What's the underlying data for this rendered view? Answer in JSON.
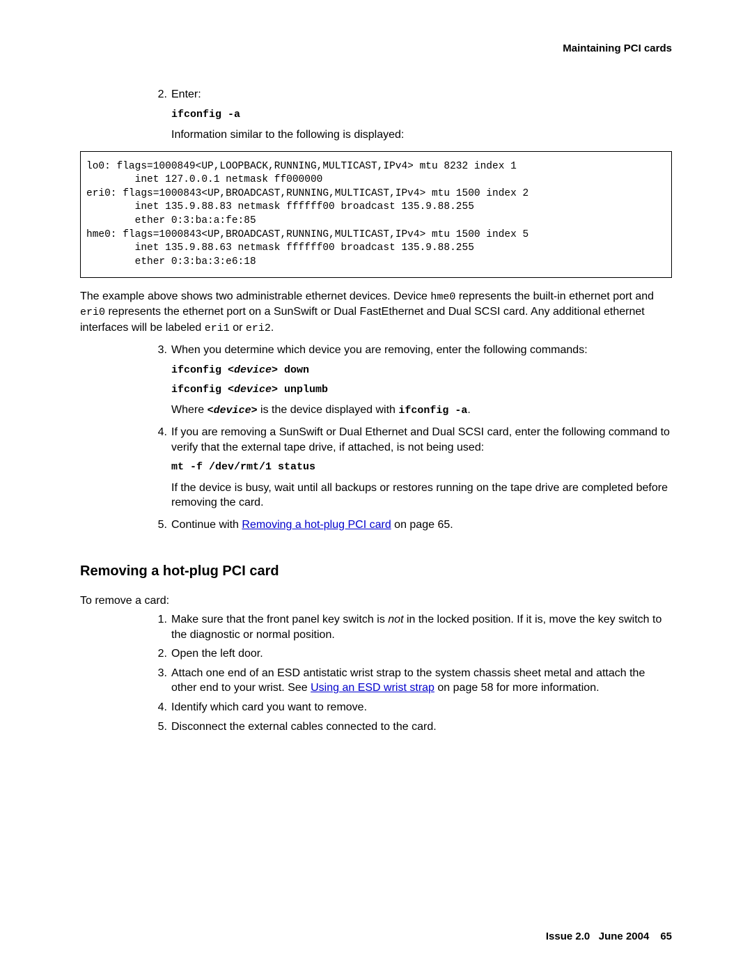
{
  "header": {
    "section_title": "Maintaining PCI cards"
  },
  "step2": {
    "num": "2.",
    "lead": "Enter:",
    "cmd": "ifconfig -a",
    "followup": "Information similar to the following is displayed:",
    "codebox": "lo0: flags=1000849<UP,LOOPBACK,RUNNING,MULTICAST,IPv4> mtu 8232 index 1\n        inet 127.0.0.1 netmask ff000000\neri0: flags=1000843<UP,BROADCAST,RUNNING,MULTICAST,IPv4> mtu 1500 index 2\n        inet 135.9.88.83 netmask ffffff00 broadcast 135.9.88.255\n        ether 0:3:ba:a:fe:85\nhme0: flags=1000843<UP,BROADCAST,RUNNING,MULTICAST,IPv4> mtu 1500 index 5\n        inet 135.9.88.63 netmask ffffff00 broadcast 135.9.88.255\n        ether 0:3:ba:3:e6:18",
    "expl_a": "The example above shows two administrable ethernet devices. Device ",
    "expl_hme0": "hme0",
    "expl_b": " represents the built-in ethernet port and ",
    "expl_eri0": "eri0",
    "expl_c": " represents the ethernet port on a SunSwift or Dual FastEthernet and Dual SCSI card. Any additional ethernet interfaces will be labeled ",
    "expl_eri1": "eri1",
    "expl_or": " or ",
    "expl_eri2": "eri2",
    "expl_dot": "."
  },
  "step3": {
    "num": "3.",
    "lead": "When you determine which device you are removing, enter the following commands:",
    "cmd1_a": "ifconfig ",
    "cmd1_b": "<device>",
    "cmd1_c": " down",
    "cmd2_a": "ifconfig ",
    "cmd2_b": "<device>",
    "cmd2_c": " unplumb",
    "where_a": "Where ",
    "where_dev": "<device>",
    "where_b": " is the device displayed with ",
    "where_cmd": "ifconfig -a",
    "where_dot": "."
  },
  "step4": {
    "num": "4.",
    "lead": "If you are removing a SunSwift or Dual Ethernet and Dual SCSI card, enter the following command to verify that the external tape drive, if attached, is not being used:",
    "cmd": "mt -f /dev/rmt/1 status",
    "tail": "If the device is busy, wait until all backups or restores running on the tape drive are completed before removing the card."
  },
  "step5": {
    "num": "5.",
    "a": "Continue with ",
    "link": "Removing a hot-plug PCI card",
    "b": " on page 65."
  },
  "sectionTitle": "Removing a hot-plug PCI card",
  "intro": "To remove a card:",
  "r1": {
    "num": "1.",
    "a": "Make sure that the front panel key switch is ",
    "not": "not",
    "b": " in the locked position. If it is, move the key switch to the diagnostic or normal position."
  },
  "r2": {
    "num": "2.",
    "text": "Open the left door."
  },
  "r3": {
    "num": "3.",
    "a": "Attach one end of an ESD antistatic wrist strap to the system chassis sheet metal and attach the other end to your wrist. See ",
    "link": "Using an ESD wrist strap",
    "b": " on page 58 for more information."
  },
  "r4": {
    "num": "4.",
    "text": "Identify which card you want to remove."
  },
  "r5": {
    "num": "5.",
    "text": "Disconnect the external cables connected to the card."
  },
  "footer": {
    "issue": "Issue 2.0",
    "date": "June 2004",
    "page": "65"
  }
}
